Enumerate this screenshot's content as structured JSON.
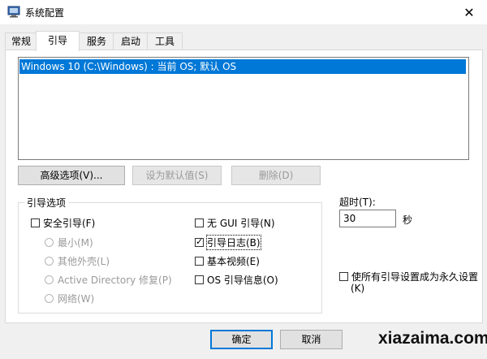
{
  "window": {
    "title": "系统配置",
    "close_glyph": "✕"
  },
  "tabs": [
    {
      "label": "常规"
    },
    {
      "label": "引导",
      "active": true
    },
    {
      "label": "服务"
    },
    {
      "label": "启动"
    },
    {
      "label": "工具"
    }
  ],
  "os_list": {
    "items": [
      {
        "label": "Windows 10 (C:\\Windows) : 当前 OS; 默认 OS",
        "selected": true
      }
    ]
  },
  "os_buttons": {
    "advanced": "高级选项(V)...",
    "set_default": "设为默认值(S)",
    "delete": "删除(D)"
  },
  "boot_options": {
    "group_label": "引导选项",
    "safe_boot": {
      "label": "安全引导(F)",
      "checked": false
    },
    "safe_modes": [
      {
        "label": "最小(M)"
      },
      {
        "label": "其他外壳(L)"
      },
      {
        "label": "Active Directory 修复(P)"
      },
      {
        "label": "网络(W)"
      }
    ],
    "no_gui": {
      "label": "无 GUI 引导(N)",
      "checked": false
    },
    "boot_log": {
      "label": "引导日志(B)",
      "checked": true
    },
    "base_video": {
      "label": "基本视频(E)",
      "checked": false
    },
    "os_boot_info": {
      "label": "OS 引导信息(O)",
      "checked": false
    }
  },
  "timeout": {
    "label": "超时(T):",
    "value": "30",
    "unit": "秒"
  },
  "permanent": {
    "label_line1": "使所有引导设置成为永久设置",
    "label_line2": "(K)",
    "checked": false
  },
  "dialog_buttons": {
    "ok": "确定",
    "cancel": "取消"
  },
  "watermark": "xiazaima.com",
  "colors": {
    "selection": "#0078d7",
    "focus_border": "#0078d7"
  }
}
